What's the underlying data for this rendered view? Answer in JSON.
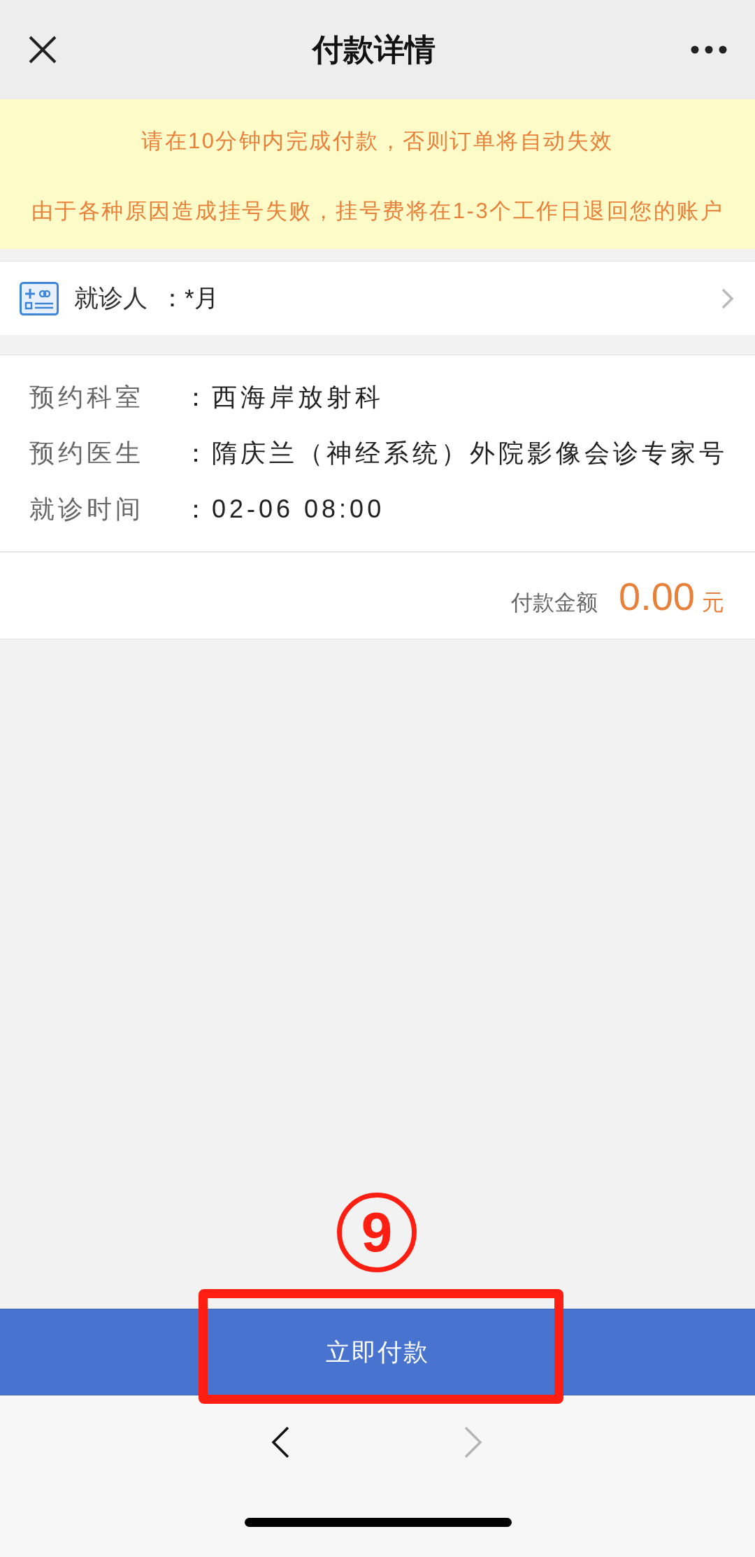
{
  "header": {
    "title": "付款详情"
  },
  "notices": [
    "请在10分钟内完成付款，否则订单将自动失效",
    "由于各种原因造成挂号失败，挂号费将在1-3个工作日退回您的账户"
  ],
  "patient": {
    "label": "就诊人",
    "value": "：*月"
  },
  "details": [
    {
      "label": "预约科室",
      "value": "：西海岸放射科"
    },
    {
      "label": "预约医生",
      "value": "：隋庆兰（神经系统）外院影像会诊专家号"
    },
    {
      "label": "就诊时间",
      "value": "：02-06 08:00"
    }
  ],
  "payment": {
    "label": "付款金额",
    "amount": "0.00",
    "unit": "元"
  },
  "annotation": {
    "step": "9"
  },
  "pay_button": {
    "label": "立即付款"
  },
  "nav": {
    "back_disabled": false,
    "forward_disabled": true
  }
}
